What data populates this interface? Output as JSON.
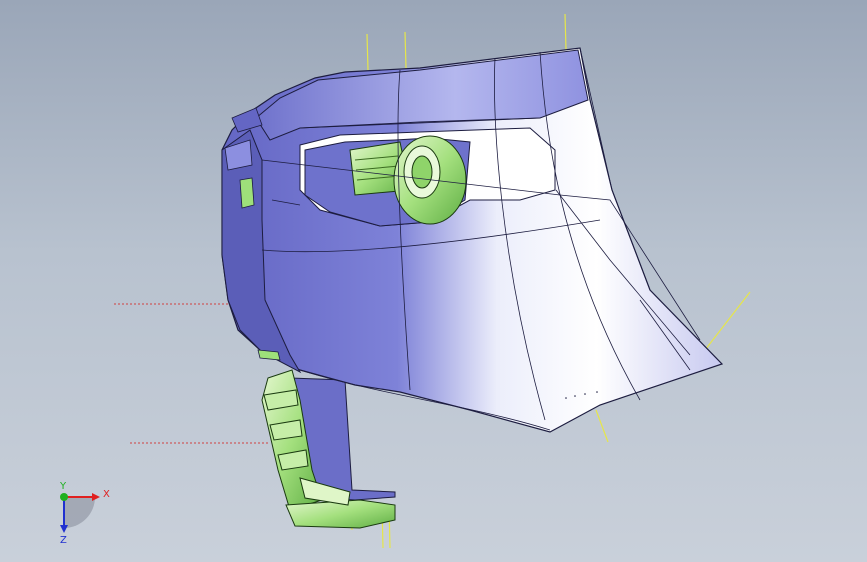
{
  "viewport": {
    "background_top": "#9aa6b8",
    "background_bottom": "#c9d0da",
    "part_color": "#7c80d6",
    "highlight_color": "#ffffff",
    "secondary_part_color": "#9ee07a",
    "guide_line_color": "#e6e64a",
    "section_line_color": "#d04040"
  },
  "triad": {
    "x_label": "X",
    "y_label": "Y",
    "z_label": "Z",
    "x_color": "#e02020",
    "y_color": "#20b020",
    "z_color": "#2030d0"
  }
}
